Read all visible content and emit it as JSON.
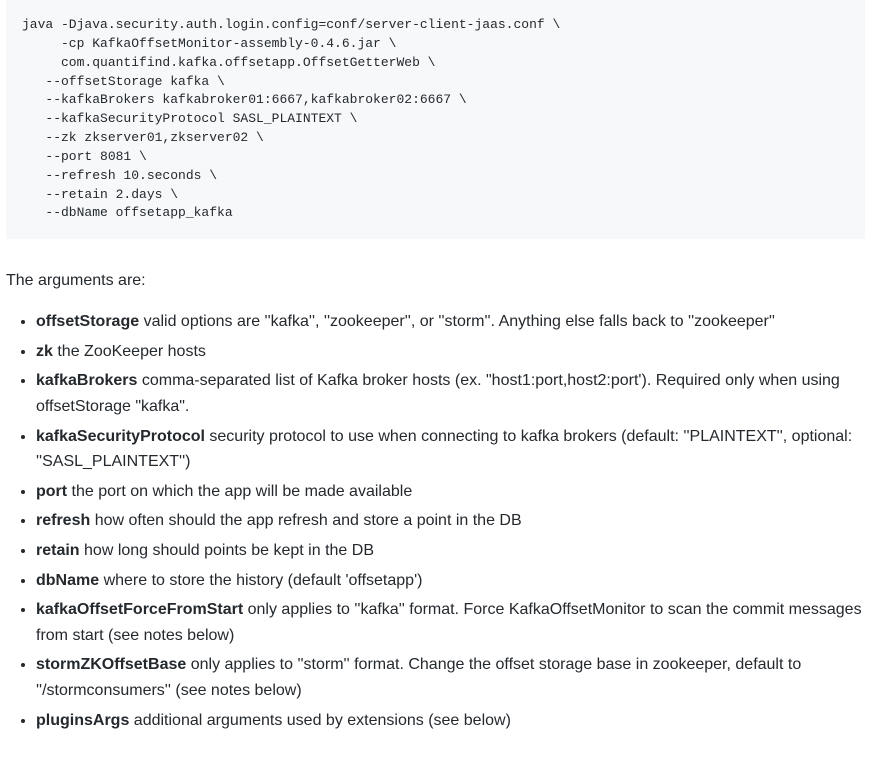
{
  "code": "java -Djava.security.auth.login.config=conf/server-client-jaas.conf \\\n     -cp KafkaOffsetMonitor-assembly-0.4.6.jar \\\n     com.quantifind.kafka.offsetapp.OffsetGetterWeb \\\n   --offsetStorage kafka \\\n   --kafkaBrokers kafkabroker01:6667,kafkabroker02:6667 \\\n   --kafkaSecurityProtocol SASL_PLAINTEXT \\\n   --zk zkserver01,zkserver02 \\\n   --port 8081 \\\n   --refresh 10.seconds \\\n   --retain 2.days \\\n   --dbName offsetapp_kafka",
  "intro": "The arguments are:",
  "args": [
    {
      "name": "offsetStorage",
      "desc": " valid options are ''kafka'', ''zookeeper'', or ''storm''. Anything else falls back to ''zookeeper''"
    },
    {
      "name": "zk",
      "desc": " the ZooKeeper hosts"
    },
    {
      "name": "kafkaBrokers",
      "desc": " comma-separated list of Kafka broker hosts (ex. \"host1:port,host2:port'). Required only when using offsetStorage \"kafka\"."
    },
    {
      "name": "kafkaSecurityProtocol",
      "desc": " security protocol to use when connecting to kafka brokers (default: ''PLAINTEXT'', optional: ''SASL_PLAINTEXT'')"
    },
    {
      "name": "port",
      "desc": " the port on which the app will be made available"
    },
    {
      "name": "refresh",
      "desc": " how often should the app refresh and store a point in the DB"
    },
    {
      "name": "retain",
      "desc": " how long should points be kept in the DB"
    },
    {
      "name": "dbName",
      "desc": " where to store the history (default 'offsetapp')"
    },
    {
      "name": "kafkaOffsetForceFromStart",
      "desc": " only applies to ''kafka'' format. Force KafkaOffsetMonitor to scan the commit messages from start (see notes below)"
    },
    {
      "name": "stormZKOffsetBase",
      "desc": " only applies to ''storm'' format. Change the offset storage base in zookeeper, default to ''/stormconsumers'' (see notes below)"
    },
    {
      "name": "pluginsArgs",
      "desc": " additional arguments used by extensions (see below)"
    }
  ]
}
